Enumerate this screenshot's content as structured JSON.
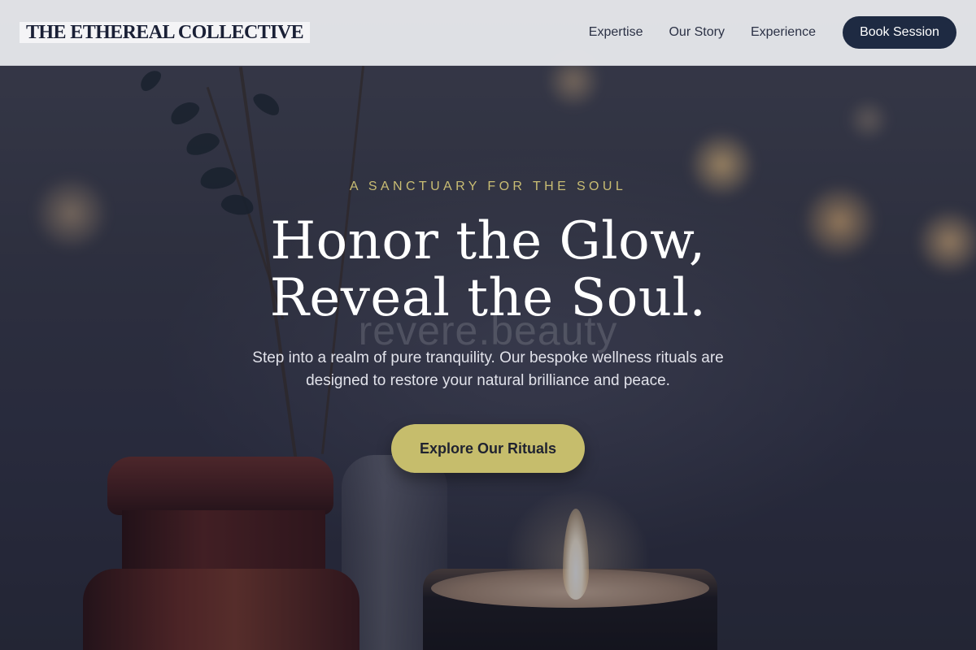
{
  "brand": {
    "name": "THE ETHEREAL COLLECTIVE"
  },
  "nav": {
    "links": [
      "Expertise",
      "Our Story",
      "Experience"
    ],
    "cta_label": "Book Session"
  },
  "hero": {
    "eyebrow": "A SANCTUARY FOR THE SOUL",
    "headline_line1": "Honor the Glow,",
    "headline_line2": "Reveal the Soul.",
    "watermark": "revere.beauty",
    "subtext": "Step into a realm of pure tranquility. Our bespoke wellness rituals are designed to restore your natural brilliance and peace.",
    "cta_label": "Explore Our Rituals"
  },
  "colors": {
    "nav_bg": "#ecedf0",
    "book_button_bg": "#1e2a42",
    "eyebrow": "#c9bd73",
    "cta_bg": "#c6bd6c",
    "heading_text": "#ffffff",
    "overlay": "#141626"
  }
}
